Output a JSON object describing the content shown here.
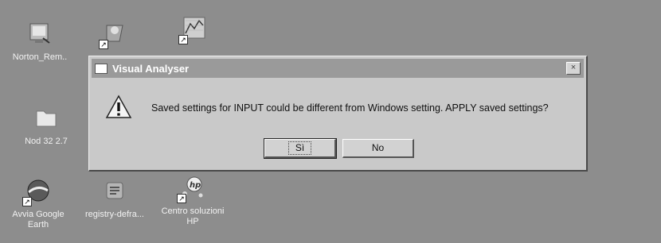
{
  "desktop": {
    "icons": [
      {
        "label": "Norton_Rem..",
        "name": "norton-icon"
      },
      {
        "label": "",
        "name": "shortcut-app-icon"
      },
      {
        "label": "",
        "name": "chart-app-icon"
      },
      {
        "label": "Nod 32 2.7",
        "name": "folder-icon"
      },
      {
        "label": "Avvia Google Earth",
        "name": "google-earth-icon"
      },
      {
        "label": "registry-defra...",
        "name": "registry-defrag-icon"
      },
      {
        "label": "Centro soluzioni HP",
        "name": "hp-solution-center-icon"
      }
    ]
  },
  "dialog": {
    "title": "Visual Analyser",
    "close_label": "×",
    "message": "Saved settings for INPUT could be different from Windows setting. APPLY saved settings?",
    "buttons": {
      "yes": "Sì",
      "no": "No"
    }
  }
}
